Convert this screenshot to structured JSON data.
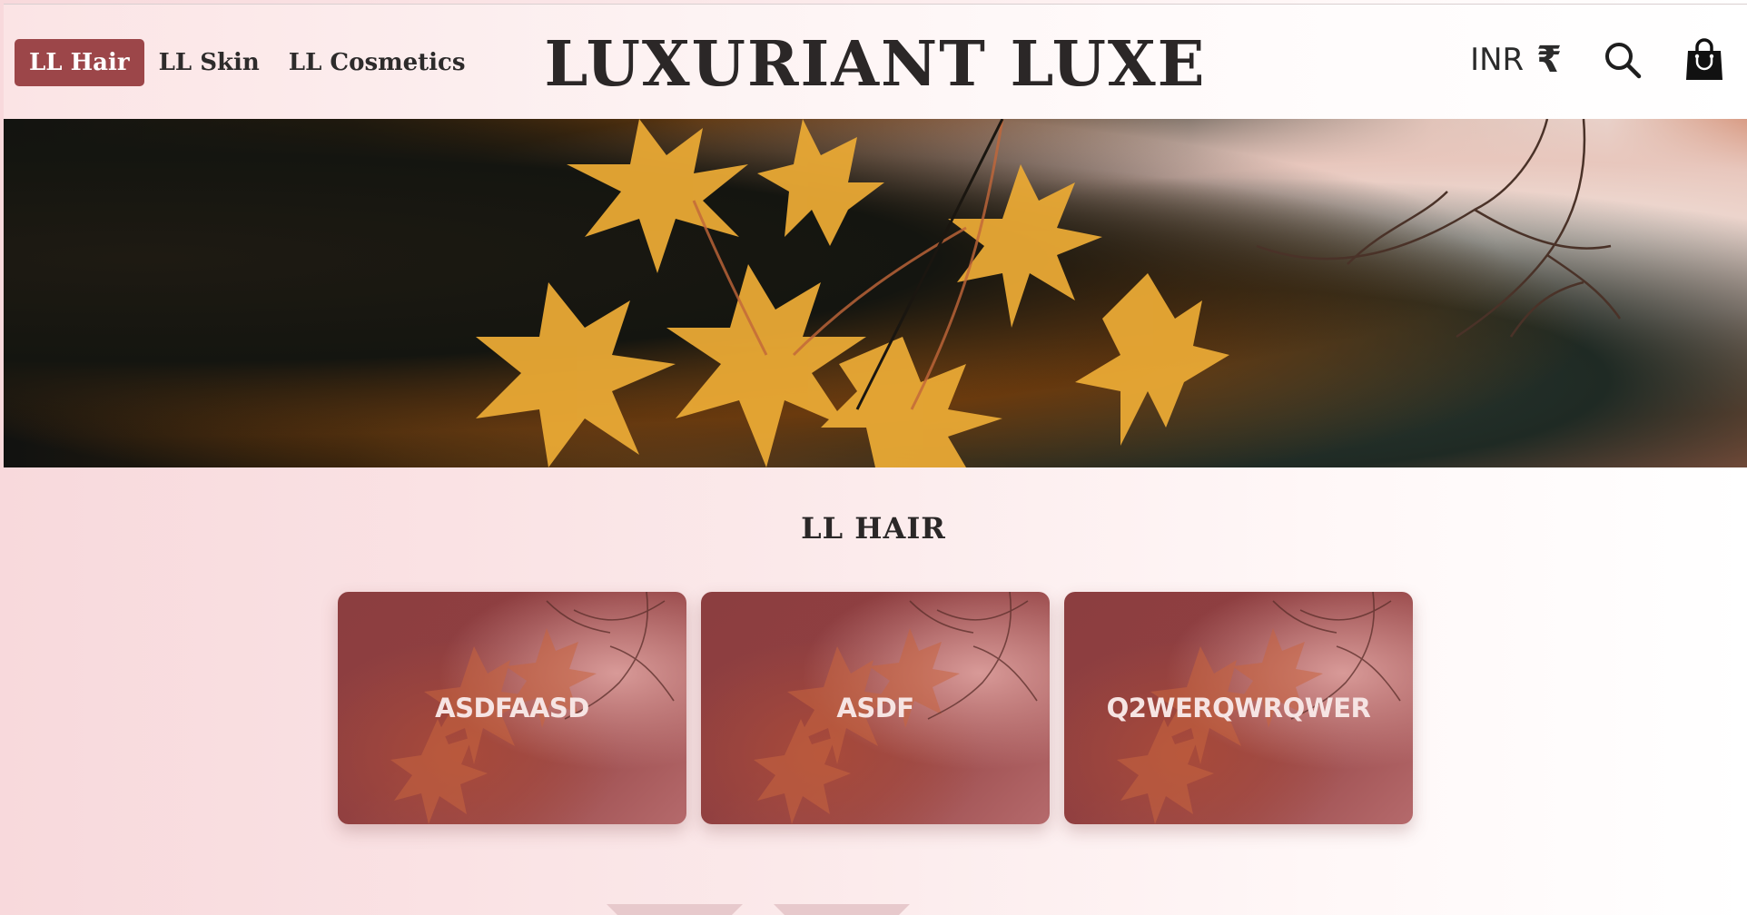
{
  "nav": {
    "items": [
      {
        "label": "LL Hair",
        "active": true
      },
      {
        "label": "LL Skin",
        "active": false
      },
      {
        "label": "LL Cosmetics",
        "active": false
      }
    ]
  },
  "brand": {
    "title": "LUXURIANT LUXE"
  },
  "header_right": {
    "currency_label": "INR",
    "currency_symbol": "₹",
    "search_icon": "search-icon",
    "cart_icon": "shopping-bag-icon"
  },
  "section": {
    "title": "LL HAIR"
  },
  "cards": [
    {
      "label": "ASDFAASD"
    },
    {
      "label": "ASDF"
    },
    {
      "label": "Q2WERQWRQWER"
    }
  ],
  "colors": {
    "accent": "#9c4649",
    "text": "#2b2727",
    "card": "#8f3f41"
  }
}
